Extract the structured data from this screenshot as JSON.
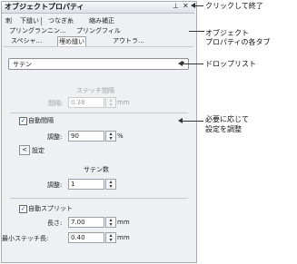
{
  "panel": {
    "title": "オブジェクトプロパティ",
    "pin_glyph": "⊥",
    "close_glyph": "✕",
    "tab_rows": [
      [
        "刺",
        "下縫い",
        "つなぎ糸",
        "縮み補正"
      ],
      [
        "プリングランニン...",
        "プリングフィル"
      ],
      [
        "スペシャ...",
        "埋め縫い",
        "アウトラ..."
      ]
    ],
    "dropdown_value": "サテン",
    "section_stitch_density": "ステッチ間隔",
    "spacing_label": "間隔:",
    "spacing_value": "0.38",
    "spacing_unit": "mm",
    "auto_spacing_label": "自動間隔",
    "adjust_label": "調整:",
    "adjust_value": "90",
    "adjust_unit": "%",
    "settings_button": "設定",
    "satin_count_title": "サテン数",
    "satin_adjust_label": "調整:",
    "satin_adjust_value": "1",
    "auto_split_label": "自動スプリット",
    "length_label": "長さ:",
    "length_value": "7.00",
    "length_unit": "mm",
    "min_stitch_label": "最小ステッチ長:",
    "min_stitch_value": "0.40",
    "min_stitch_unit": "mm"
  },
  "callouts": {
    "close": "クリックして終了",
    "tabs_line1": "オブジェクト",
    "tabs_line2": "プロパティの各タブ",
    "dropdown": "ドロップリスト",
    "adjust_line1": "必要に応じて",
    "adjust_line2": "設定を調整"
  }
}
